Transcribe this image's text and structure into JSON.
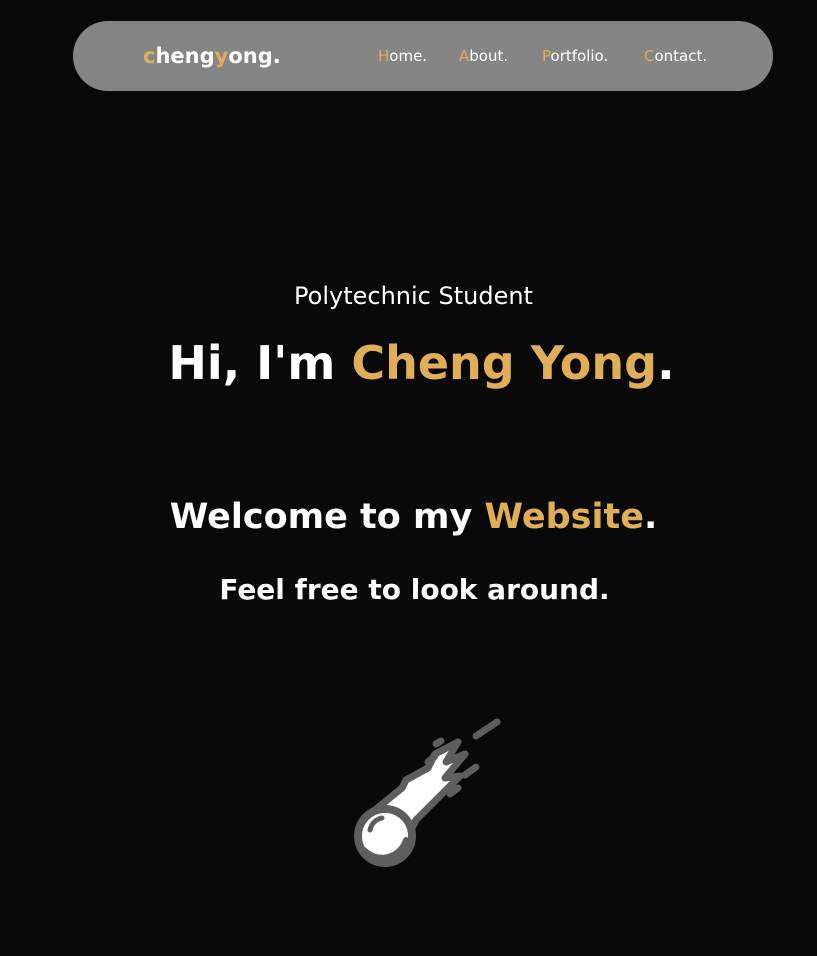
{
  "colors": {
    "background": "#090909",
    "navbar": "#858585",
    "accent": "#e1ae58",
    "text": "#ffffff",
    "meteor_outline": "#5e5e5e"
  },
  "nav": {
    "brand": {
      "part1_accent": "c",
      "part2": "heng",
      "part3_accent": "y",
      "part4": "ong."
    },
    "links": [
      {
        "first": "H",
        "rest": "ome."
      },
      {
        "first": "A",
        "rest": "bout."
      },
      {
        "first": "P",
        "rest": "ortfolio."
      },
      {
        "first": "C",
        "rest": "ontact."
      }
    ]
  },
  "hero": {
    "subtitle": "Polytechnic Student",
    "greeting": "Hi, I'm ",
    "name": "Cheng Yong",
    "name_suffix": ".",
    "welcome_prefix": "Welcome to my ",
    "welcome_accent": "Website",
    "welcome_suffix": ".",
    "tagline": "Feel free to look around."
  },
  "icons": {
    "scroll_indicator": "meteor-icon"
  }
}
